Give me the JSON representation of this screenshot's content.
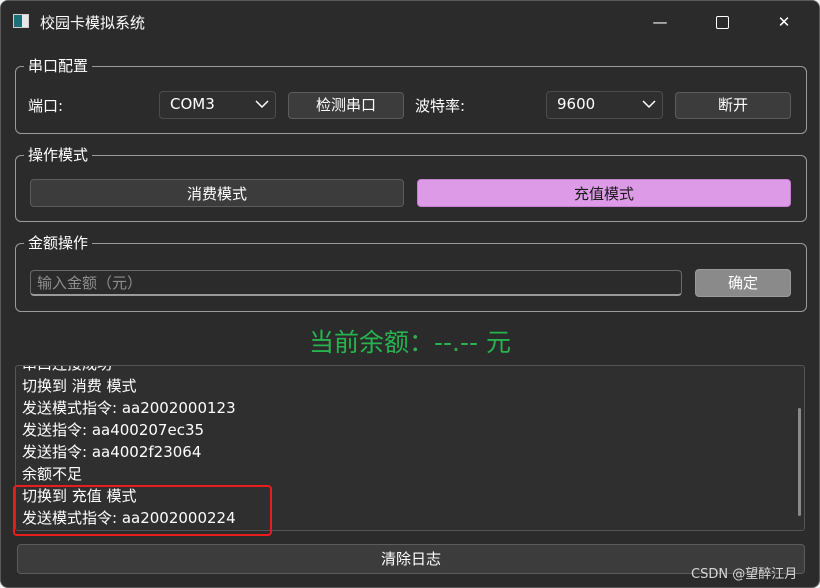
{
  "window": {
    "title": "校园卡模拟系统",
    "min_glyph": "—",
    "close_glyph": "✕"
  },
  "serial": {
    "group_title": "串口配置",
    "port_label": "端口:",
    "port_value": "COM3",
    "detect_button": "检测串口",
    "baud_label": "波特率:",
    "baud_value": "9600",
    "disconnect_button": "断开"
  },
  "mode": {
    "group_title": "操作模式",
    "consume_button": "消费模式",
    "recharge_button": "充值模式",
    "active": "recharge",
    "active_color": "#dd9ae6"
  },
  "amount": {
    "group_title": "金额操作",
    "placeholder": "输入金额（元）",
    "value": "",
    "confirm_button": "确定"
  },
  "balance": {
    "text": "当前余额：--.-- 元",
    "color": "#27b34f"
  },
  "log": {
    "lines": [
      "串口连接成功",
      "切换到 消费 模式",
      "发送模式指令: aa2002000123",
      "发送指令: aa400207ec35",
      "发送指令: aa4002f23064",
      "余额不足",
      "切换到 充值 模式",
      "发送模式指令: aa2002000224"
    ],
    "highlight_color": "#e81d1d"
  },
  "clear_button": "清除日志",
  "watermark": "CSDN @望醉江月"
}
